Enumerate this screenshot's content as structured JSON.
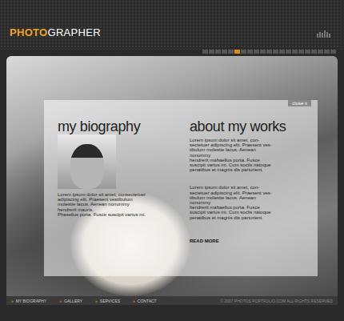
{
  "logo": {
    "accent": "PHOTO",
    "rest": "GRAPHER"
  },
  "pager": [
    {
      "selected": false
    },
    {
      "selected": false
    },
    {
      "selected": false
    },
    {
      "selected": false
    },
    {
      "selected": false
    },
    {
      "selected": true
    },
    {
      "selected": false
    },
    {
      "selected": false
    },
    {
      "selected": false
    },
    {
      "selected": false
    },
    {
      "selected": false
    },
    {
      "selected": false
    },
    {
      "selected": false
    },
    {
      "selected": false
    },
    {
      "selected": false
    },
    {
      "selected": false
    },
    {
      "selected": false
    },
    {
      "selected": false
    },
    {
      "selected": false
    },
    {
      "selected": false
    },
    {
      "selected": false
    }
  ],
  "panel": {
    "close": "close x",
    "biography": {
      "title": "my biography",
      "lines": [
        "Lorem ipsum dolor sit amet, consectetuer",
        "adipiscing elit. Praesent vestibulum",
        "molestie lacus. Aenean nonummy",
        "hendrerit mauris.",
        "Phasellus porta. Fusce suscipit varius mi."
      ]
    },
    "works": {
      "title": "about my works",
      "paragraphs": [
        [
          "Lorem ipsum dolor sit amet, con-",
          "sectetuer adipiscing elit. Praesent ves-",
          "tibulum molestie lacus. Aenean",
          "nonummy",
          "hendrerit mahaellus porta. Fusce",
          "suscipit varius mi. Cum sociis natoque",
          "penatibus et magnis dis parturient."
        ],
        [
          "Lorem ipsum dolor sit amet, con-",
          "sectetuer adipiscing elit. Praesent ves-",
          "tibulum molestie lacus. Aenean",
          "nonummy",
          "hendrerit mahaellus porta. Fusce",
          "suscipit varius mi. Cum sociis natoque",
          "penatibus et magnis dis parturient."
        ]
      ],
      "more": "READ MORE"
    }
  },
  "nav": {
    "marker": "»",
    "items": [
      "MY BIOGRAPHY",
      "GALLERY",
      "SERVICES",
      "CONTACT"
    ]
  },
  "copyright": "© 2007 PHOTOS PORTFOLIO.COM ALL RIGHTS RESERVED"
}
